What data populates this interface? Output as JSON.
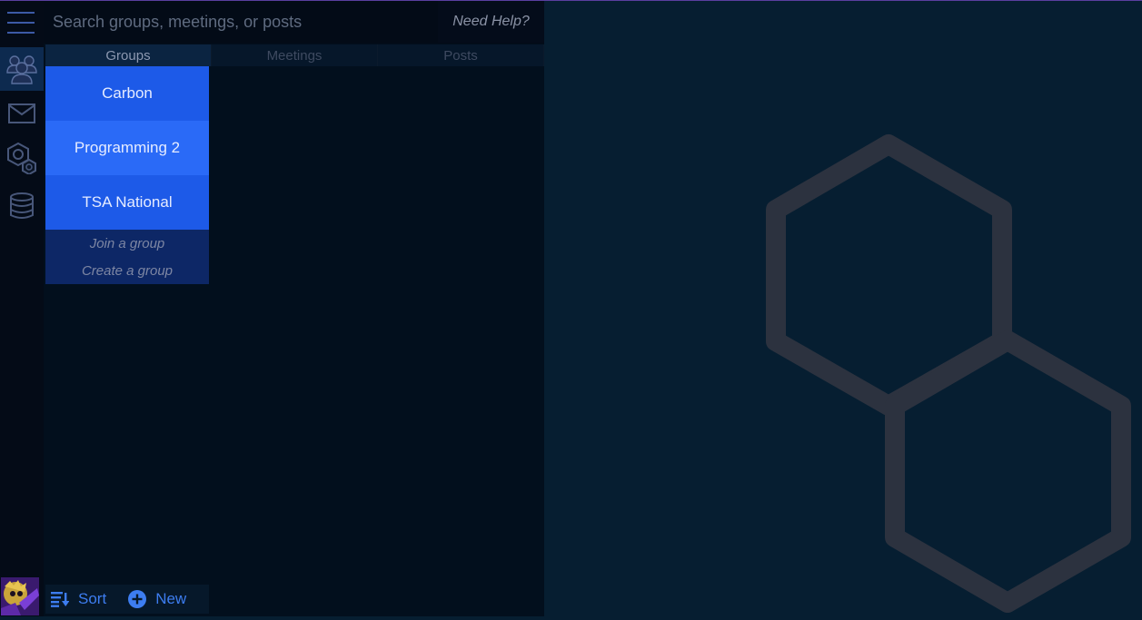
{
  "search": {
    "placeholder": "Search groups, meetings, or posts"
  },
  "help_label": "Need Help?",
  "rail": {
    "icons": [
      "groups-icon",
      "mail-icon",
      "settings-hexagons-icon",
      "database-icon"
    ]
  },
  "tabs": [
    {
      "label": "Groups",
      "active": true
    },
    {
      "label": "Meetings",
      "active": false
    },
    {
      "label": "Posts",
      "active": false
    }
  ],
  "groups": [
    {
      "name": "Carbon"
    },
    {
      "name": "Programming 2"
    },
    {
      "name": "TSA National"
    }
  ],
  "group_actions": {
    "join": "Join a group",
    "create": "Create a group"
  },
  "bottom": {
    "sort": "Sort",
    "new": "New"
  },
  "colors": {
    "accent": "#1d5ae8",
    "background": "#061e31",
    "panel": "#020f1d",
    "logo": "#2c323f"
  }
}
